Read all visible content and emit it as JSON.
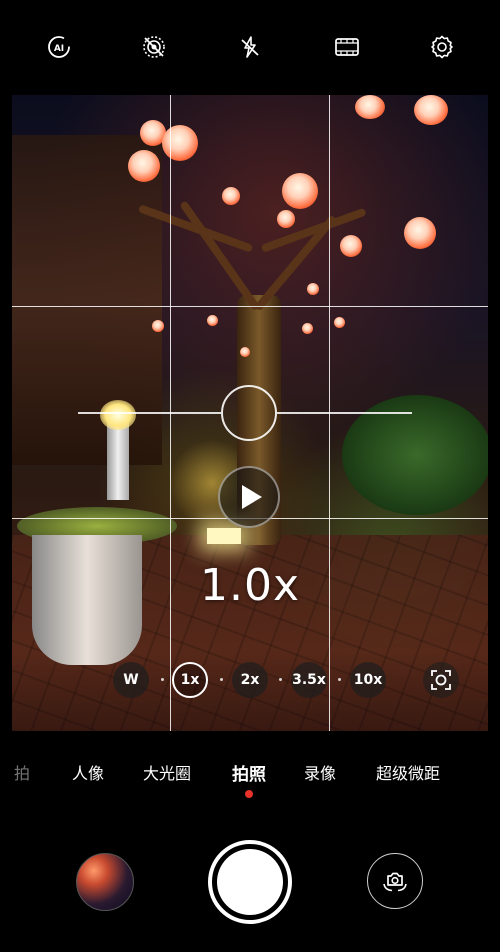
{
  "top_bar": {
    "icons": [
      "ai-icon",
      "live-photo-off-icon",
      "flash-off-icon",
      "film-filter-icon",
      "settings-icon"
    ]
  },
  "viewfinder": {
    "zoom_readout": "1.0x",
    "zoom_options": [
      "W",
      "1x",
      "2x",
      "3.5x",
      "10x"
    ],
    "selected_zoom": "1x"
  },
  "modes": {
    "items": [
      "拍",
      "人像",
      "大光圈",
      "拍照",
      "录像",
      "超级微距"
    ],
    "active": "拍照"
  },
  "colors": {
    "accent": "#e8322a",
    "background": "#000000"
  }
}
